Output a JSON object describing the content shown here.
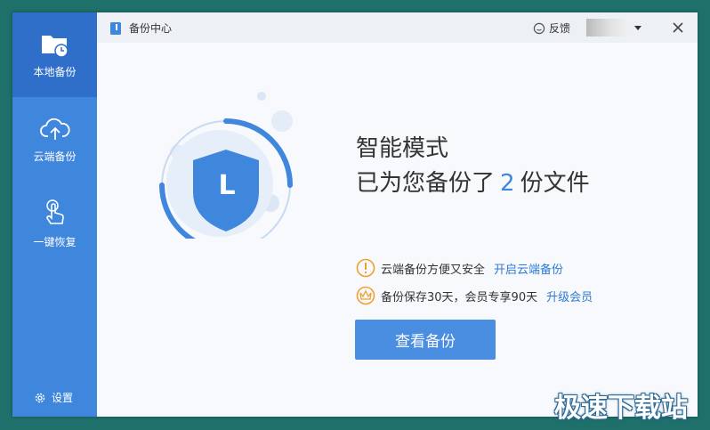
{
  "sidebar": {
    "items": [
      {
        "label": "本地备份",
        "icon": "local-folder-icon",
        "active": true
      },
      {
        "label": "云端备份",
        "icon": "cloud-upload-icon",
        "active": false
      },
      {
        "label": "一键恢复",
        "icon": "tap-hand-icon",
        "active": false
      }
    ],
    "settings_label": "设置"
  },
  "titlebar": {
    "title": "备份中心",
    "feedback_label": "反馈"
  },
  "main": {
    "shield_letter": "L",
    "mode_title": "智能模式",
    "status_prefix": "已为您备份了",
    "backup_count": "2",
    "status_suffix": "份文件",
    "notice_cloud": {
      "text": "云端备份方便又安全",
      "link": "开启云端备份"
    },
    "notice_vip": {
      "text": "备份保存30天，会员专享90天",
      "link": "升级会员"
    },
    "view_button": "查看备份"
  },
  "watermark": "极速下载站",
  "colors": {
    "sidebar": "#3f86dd",
    "sidebar_active": "#2f6fca",
    "accent": "#4a8ee2",
    "warning": "#f0a030"
  }
}
